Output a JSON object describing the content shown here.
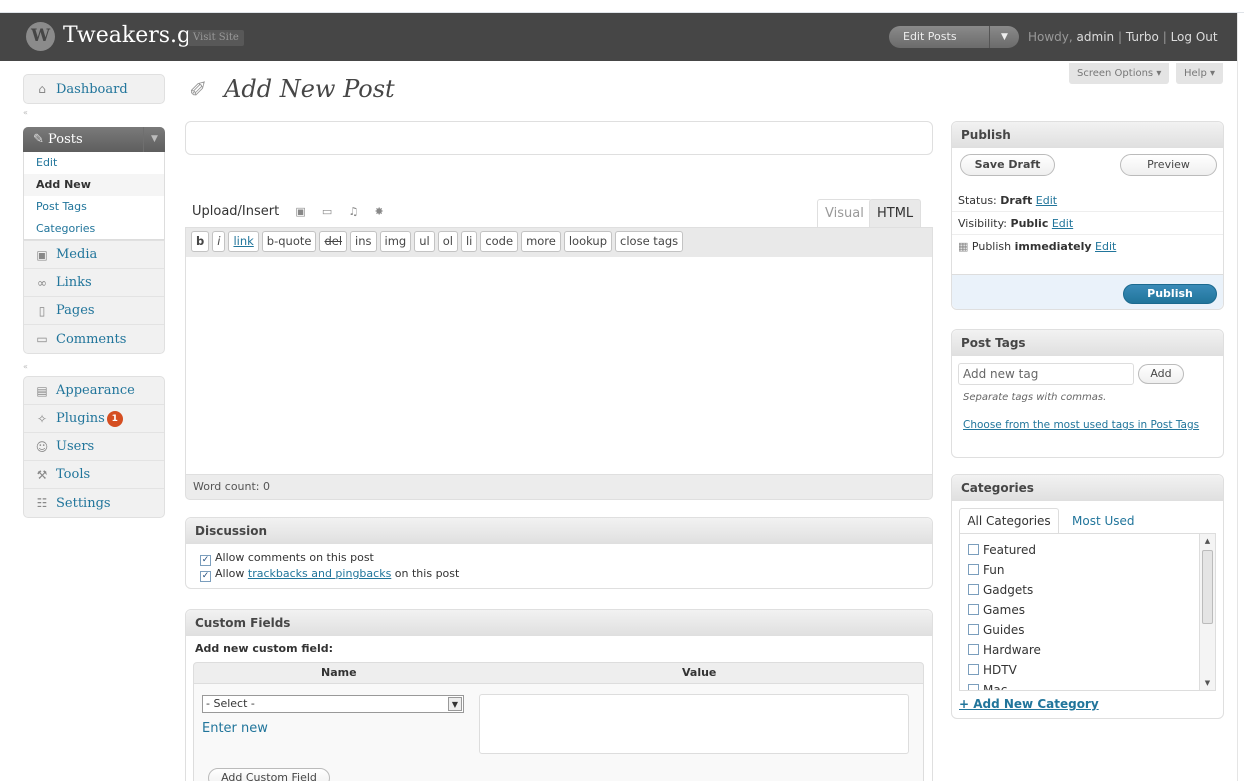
{
  "header": {
    "site_title": "Tweakers.gr",
    "visit_site": "Visit Site",
    "favorite_action": "Edit Posts",
    "howdy": "Howdy,",
    "user": "admin",
    "turbo": "Turbo",
    "logout": "Log Out",
    "sep": "|"
  },
  "screen_options": "Screen Options",
  "help": "Help",
  "menu": {
    "dashboard": "Dashboard",
    "posts": "Posts",
    "posts_sub": [
      "Edit",
      "Add New",
      "Post Tags",
      "Categories"
    ],
    "media": "Media",
    "links": "Links",
    "pages": "Pages",
    "comments": "Comments",
    "appearance": "Appearance",
    "plugins": "Plugins",
    "plugins_badge": "1",
    "users": "Users",
    "tools": "Tools",
    "settings": "Settings"
  },
  "page_title": "Add New Post",
  "editor": {
    "upload_insert": "Upload/Insert",
    "tab_visual": "Visual",
    "tab_html": "HTML",
    "quicktags": [
      "b",
      "i",
      "link",
      "b-quote",
      "del",
      "ins",
      "img",
      "ul",
      "ol",
      "li",
      "code",
      "more",
      "lookup",
      "close tags"
    ],
    "word_count": "Word count: 0"
  },
  "discussion": {
    "title": "Discussion",
    "allow_comments": "Allow comments on this post",
    "allow_prefix": "Allow",
    "trackbacks_link": "trackbacks and pingbacks",
    "allow_suffix": "on this post"
  },
  "custom_fields": {
    "title": "Custom Fields",
    "add_label": "Add new custom field:",
    "col_name": "Name",
    "col_value": "Value",
    "select_value": "- Select -",
    "enter_new": "Enter new",
    "add_button": "Add Custom Field"
  },
  "publish": {
    "title": "Publish",
    "save_draft": "Save Draft",
    "preview": "Preview",
    "status_label": "Status:",
    "status_value": "Draft",
    "visibility_label": "Visibility:",
    "visibility_value": "Public",
    "publish_label": "Publish",
    "publish_when": "immediately",
    "edit": "Edit",
    "publish_button": "Publish"
  },
  "post_tags": {
    "title": "Post Tags",
    "placeholder": "Add new tag",
    "add_button": "Add",
    "hint": "Separate tags with commas.",
    "choose_link": "Choose from the most used tags in Post Tags"
  },
  "categories": {
    "title": "Categories",
    "tab_all": "All Categories",
    "tab_most_used": "Most Used",
    "items": [
      "Featured",
      "Fun",
      "Gadgets",
      "Games",
      "Guides",
      "Hardware",
      "HDTV",
      "Mac"
    ],
    "add_new": "+ Add New Category"
  },
  "colors": {
    "header_bg": "#464646",
    "link": "#21759b",
    "publish_button": "#21759b",
    "badge": "#d54e21"
  }
}
